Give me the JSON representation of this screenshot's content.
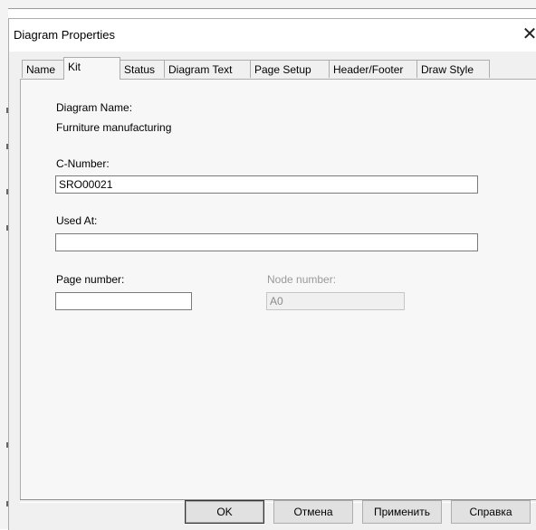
{
  "window": {
    "title": "Diagram Properties",
    "close_glyph": "✕"
  },
  "tabs": [
    {
      "label": "Name"
    },
    {
      "label": "Kit",
      "active": true
    },
    {
      "label": "Status"
    },
    {
      "label": "Diagram Text"
    },
    {
      "label": "Page Setup"
    },
    {
      "label": "Header/Footer"
    },
    {
      "label": "Draw Style"
    }
  ],
  "kit": {
    "diagram_name_label": "Diagram Name:",
    "diagram_name_value": "Furniture manufacturing",
    "c_number_label": "C-Number:",
    "c_number_value": "SRO00021",
    "used_at_label": "Used At:",
    "used_at_value": "",
    "page_number_label": "Page number:",
    "page_number_value": "",
    "node_number_label": "Node number:",
    "node_number_value": "A0"
  },
  "buttons": {
    "ok": "OK",
    "cancel": "Отмена",
    "apply": "Применить",
    "help": "Справка"
  }
}
